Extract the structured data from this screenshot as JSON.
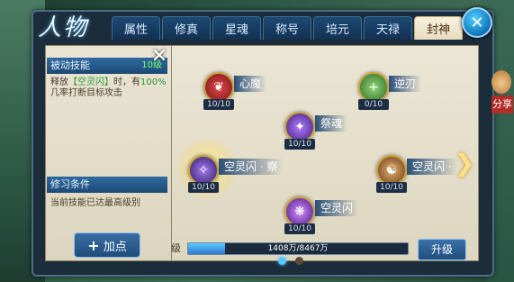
{
  "header": {
    "title": "人物",
    "tabs": [
      "属性",
      "修真",
      "星魂",
      "称号",
      "培元",
      "天禄",
      "封神"
    ],
    "active_tab": "封神"
  },
  "share": {
    "label": "分享"
  },
  "left_panel": {
    "passive_skill_label": "被动技能",
    "level": "10级",
    "desc_prefix": "释放",
    "desc_skill": "【空灵闪】",
    "desc_mid": "时，有",
    "desc_chance": "100%",
    "desc_suffix": "几率打断目标攻击",
    "condition_label": "修习条件",
    "condition_text": "当前技能已达最高级别",
    "add_point_label": "加点"
  },
  "skills": [
    {
      "name": "心魔",
      "count": "10/10",
      "icon": "heart-demon-icon",
      "color": "#b3282d"
    },
    {
      "name": "逆刃",
      "count": "0/10",
      "icon": "reverse-blade-icon",
      "color": "#3f7a2e"
    },
    {
      "name": "祭魂",
      "count": "10/10",
      "icon": "soul-rite-icon",
      "color": "#6b3fb0"
    },
    {
      "name": "空灵闪 · 察",
      "count": "10/10",
      "icon": "void-flash-insight-icon",
      "color": "#5b3aa8"
    },
    {
      "name": "空灵闪 ·",
      "count": "10/10",
      "icon": "void-flash-icon",
      "color": "#8a5a2a"
    },
    {
      "name": "空灵闪",
      "count": "10/10",
      "icon": "void-flash-base-icon",
      "color": "#7e3db8"
    }
  ],
  "progress": {
    "level_char": "级",
    "text": "1408万/8467万",
    "fraction": 0.166
  },
  "upgrade_label": "升级",
  "page": {
    "total": 2,
    "current": 1
  }
}
